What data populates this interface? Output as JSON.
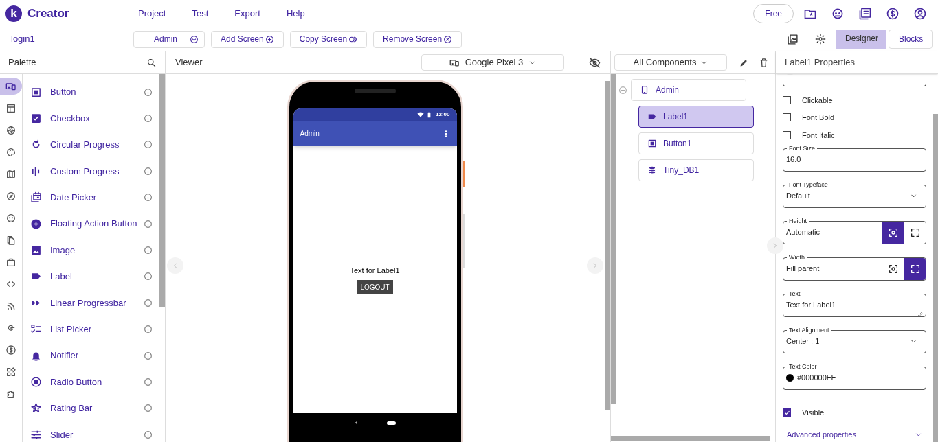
{
  "app": {
    "logo_mark": "k",
    "name": "Creator"
  },
  "menu": [
    "Project",
    "Test",
    "Export",
    "Help"
  ],
  "plan_badge": "Free",
  "project_name": "login1",
  "screen_select": {
    "value": "Admin"
  },
  "screen_buttons": [
    {
      "label": "Add Screen",
      "kind": "add"
    },
    {
      "label": "Copy Screen",
      "kind": "copy"
    },
    {
      "label": "Remove Screen",
      "kind": "remove"
    }
  ],
  "view_tabs": [
    {
      "label": "Designer",
      "selected": true
    },
    {
      "label": "Blocks",
      "selected": false
    }
  ],
  "palette": {
    "title": "Palette",
    "categories": [
      {
        "kind": "devices",
        "selected": true
      },
      {
        "kind": "layout",
        "selected": false
      },
      {
        "kind": "media",
        "selected": false
      },
      {
        "kind": "palette",
        "selected": false
      },
      {
        "kind": "map",
        "selected": false
      },
      {
        "kind": "compass",
        "selected": false
      },
      {
        "kind": "social",
        "selected": false
      },
      {
        "kind": "files",
        "selected": false
      },
      {
        "kind": "briefcase",
        "selected": false
      },
      {
        "kind": "code",
        "selected": false
      },
      {
        "kind": "rss",
        "selected": false
      },
      {
        "kind": "google",
        "selected": false
      },
      {
        "kind": "dollar",
        "selected": false
      },
      {
        "kind": "widgets",
        "selected": false
      },
      {
        "kind": "puzzle",
        "selected": false
      }
    ],
    "items": [
      {
        "label": "Button",
        "kind": "button"
      },
      {
        "label": "Checkbox",
        "kind": "checkbox"
      },
      {
        "label": "Circular Progress",
        "kind": "circular"
      },
      {
        "label": "Custom Progress",
        "kind": "custom"
      },
      {
        "label": "Date Picker",
        "kind": "date"
      },
      {
        "label": "Floating Action Button",
        "kind": "fab"
      },
      {
        "label": "Image",
        "kind": "image"
      },
      {
        "label": "Label",
        "kind": "label"
      },
      {
        "label": "Linear Progressbar",
        "kind": "linear"
      },
      {
        "label": "List Picker",
        "kind": "list"
      },
      {
        "label": "Notifier",
        "kind": "bell"
      },
      {
        "label": "Radio Button",
        "kind": "radio"
      },
      {
        "label": "Rating Bar",
        "kind": "star"
      },
      {
        "label": "Slider",
        "kind": "slider"
      }
    ]
  },
  "viewer": {
    "title": "Viewer",
    "device": "Google Pixel 3",
    "phone": {
      "time": "12:00",
      "app_title": "Admin",
      "label_text": "Text for Label1",
      "button_text": "LOGOUT"
    }
  },
  "components": {
    "filter": "All Components",
    "tree": [
      {
        "label": "Admin",
        "kind": "screen",
        "expanded": true,
        "selected": false,
        "children": [
          {
            "label": "Label1",
            "kind": "label",
            "selected": true
          },
          {
            "label": "Button1",
            "kind": "button",
            "selected": false
          },
          {
            "label": "Tiny_DB1",
            "kind": "db",
            "selected": false
          }
        ]
      }
    ]
  },
  "properties": {
    "title": "Label1 Properties",
    "items": [
      {
        "kind": "cut_color"
      },
      {
        "kind": "checkbox",
        "label": "Clickable",
        "checked": false
      },
      {
        "kind": "checkbox",
        "label": "Font Bold",
        "checked": false
      },
      {
        "kind": "checkbox",
        "label": "Font Italic",
        "checked": false
      },
      {
        "kind": "field",
        "label": "Font Size",
        "value": "16.0"
      },
      {
        "kind": "select",
        "label": "Font Typeface",
        "value": "Default"
      },
      {
        "kind": "size",
        "label": "Height",
        "value": "Automatic",
        "options": [
          {
            "kind": "automatic",
            "selected": true
          },
          {
            "kind": "fill",
            "selected": false
          }
        ]
      },
      {
        "kind": "size",
        "label": "Width",
        "value": "Fill parent",
        "options": [
          {
            "kind": "automatic",
            "selected": false
          },
          {
            "kind": "fill",
            "selected": true
          }
        ]
      },
      {
        "kind": "textarea",
        "label": "Text",
        "value": "Text for Label1"
      },
      {
        "kind": "select",
        "label": "Text Alignment",
        "value": "Center : 1"
      },
      {
        "kind": "color",
        "label": "Text Color",
        "value": "#000000FF",
        "color": "#000000"
      },
      {
        "kind": "checkbox",
        "label": "Visible",
        "checked": true
      }
    ],
    "advanced": "Advanced properties"
  }
}
